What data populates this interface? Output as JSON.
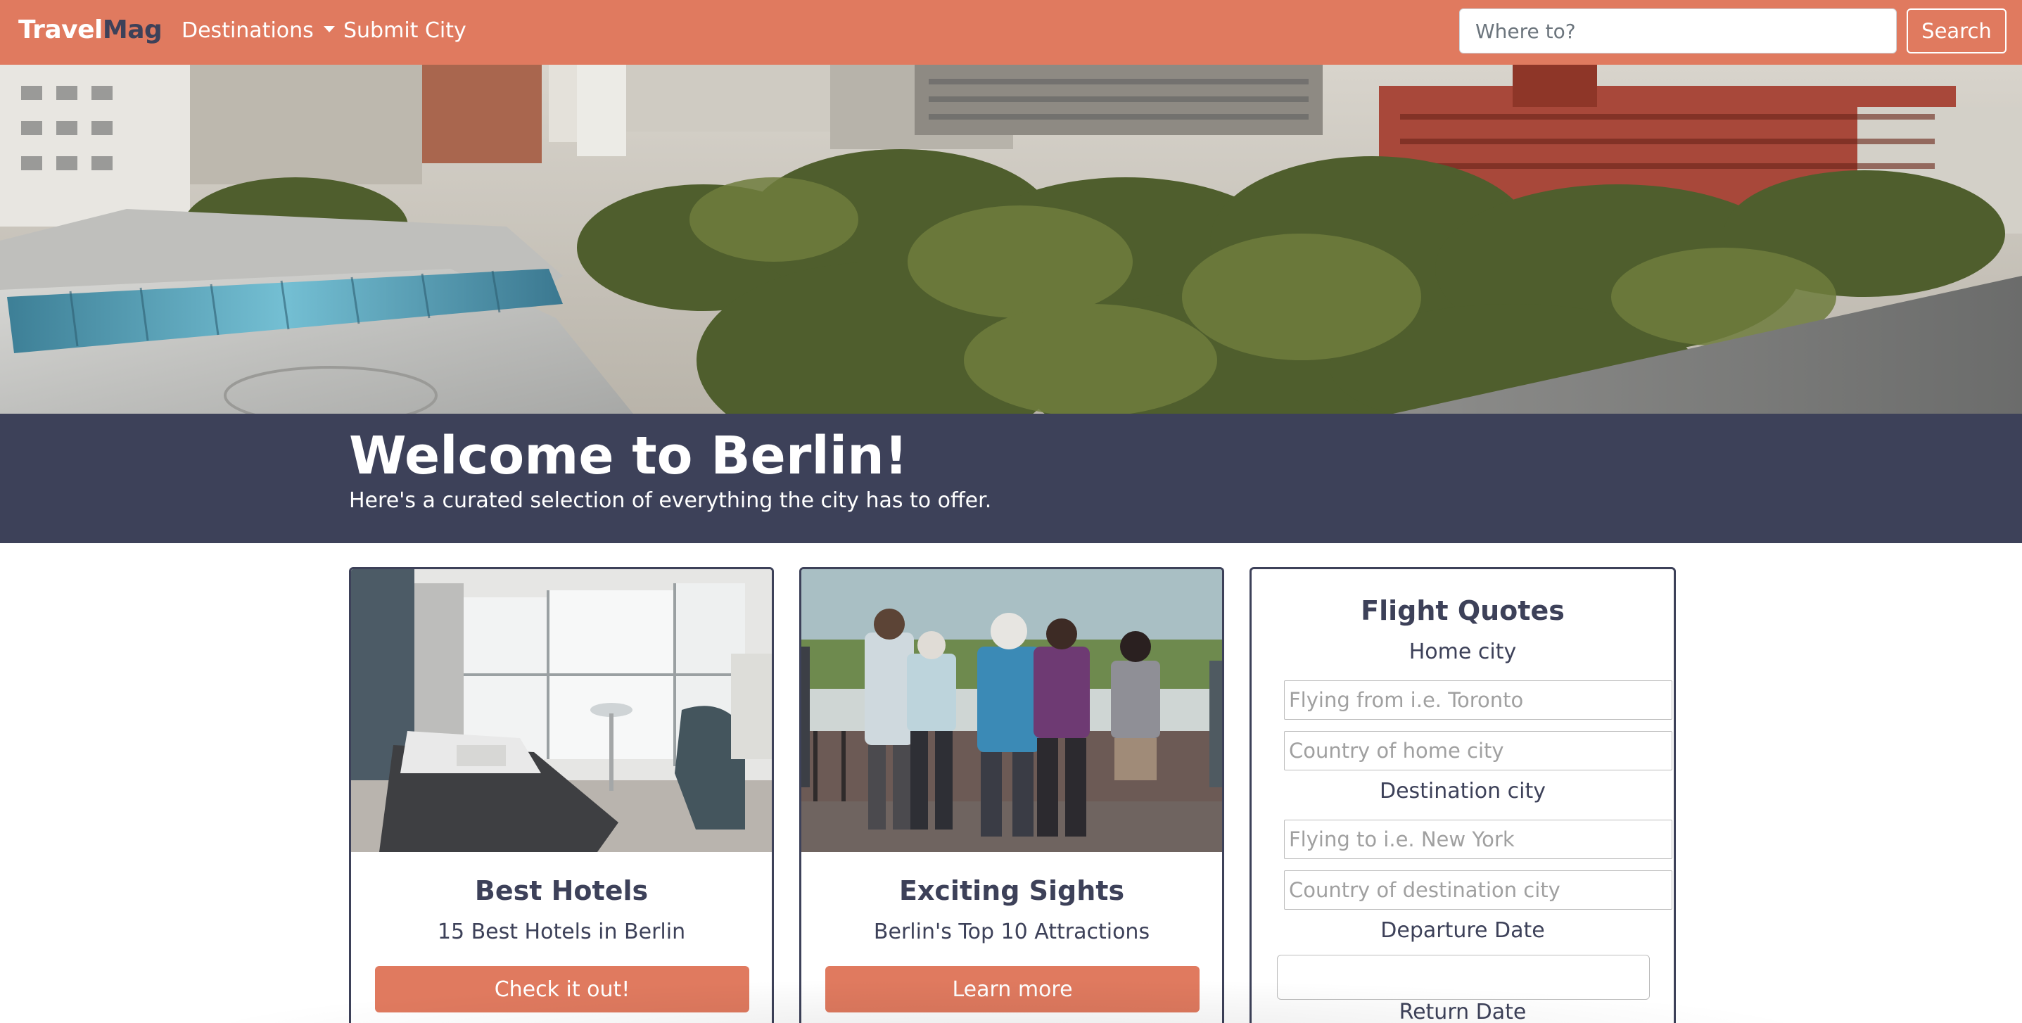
{
  "navbar": {
    "brand_part1": "Travel",
    "brand_part2": "Mag",
    "destinations_label": "Destinations",
    "submit_city_label": "Submit City",
    "search_placeholder": "Where to?",
    "search_button_label": "Search"
  },
  "jumbotron": {
    "title": "Welcome to Berlin!",
    "subtitle": "Here's a curated selection of everything the city has to offer."
  },
  "cards": [
    {
      "title": "Best Hotels",
      "text": "15 Best Hotels in Berlin",
      "button_label": "Check it out!"
    },
    {
      "title": "Exciting Sights",
      "text": "Berlin's Top 10 Attractions",
      "button_label": "Learn more"
    }
  ],
  "flight_form": {
    "title": "Flight Quotes",
    "home_city_label": "Home city",
    "home_city_placeholder": "Flying from i.e. Toronto",
    "home_country_placeholder": "Country of home city",
    "destination_city_label": "Destination city",
    "destination_city_placeholder": "Flying to i.e. New York",
    "destination_country_placeholder": "Country of destination city",
    "departure_label": "Departure Date",
    "return_label": "Return Date"
  },
  "colors": {
    "accent": "#e07a5f",
    "dark": "#3d4159",
    "white": "#ffffff"
  }
}
